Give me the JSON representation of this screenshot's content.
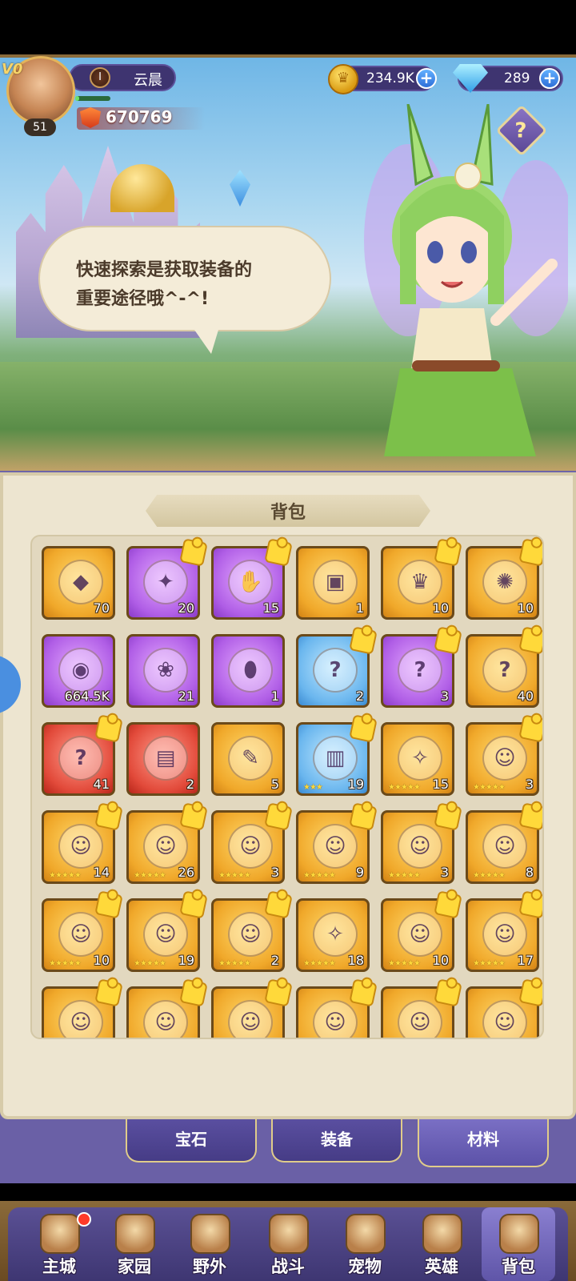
{
  "header": {
    "vip_label": "V0",
    "player_level": "51",
    "rank_icon_text": "I",
    "player_name": "云晨",
    "power": "670769",
    "xp_fraction": 0.12,
    "gold": "234.9K",
    "gems": "289",
    "help_label": "?"
  },
  "banner": {
    "dialog_line1": "快速探索是获取装备的",
    "dialog_line2": "重要途径哦^-^!"
  },
  "panel": {
    "title": "背包"
  },
  "inventory": [
    {
      "rarity": "gold",
      "icon": "gem-crystal-icon",
      "count": "70",
      "puzzle": false
    },
    {
      "rarity": "purple",
      "icon": "purple-orb-icon",
      "count": "20",
      "puzzle": true
    },
    {
      "rarity": "purple",
      "icon": "purple-hand-icon",
      "count": "15",
      "puzzle": true
    },
    {
      "rarity": "gold",
      "icon": "treasure-chest-icon",
      "count": "1",
      "puzzle": false
    },
    {
      "rarity": "gold",
      "icon": "gold-crown-icon",
      "count": "10",
      "puzzle": true
    },
    {
      "rarity": "gold",
      "icon": "gold-orb-icon",
      "count": "10",
      "puzzle": true
    },
    {
      "rarity": "purple",
      "icon": "rune-stone-icon",
      "count": "664.5K",
      "puzzle": false
    },
    {
      "rarity": "purple",
      "icon": "paw-scroll-icon",
      "count": "21",
      "puzzle": false
    },
    {
      "rarity": "purple",
      "icon": "egg-icon",
      "count": "1",
      "puzzle": false
    },
    {
      "rarity": "blue",
      "icon": "mystery-pet-icon",
      "count": "2",
      "puzzle": true
    },
    {
      "rarity": "purple",
      "icon": "mystery-pet-icon",
      "count": "3",
      "puzzle": true
    },
    {
      "rarity": "gold",
      "icon": "mystery-pet-icon",
      "count": "40",
      "puzzle": true
    },
    {
      "rarity": "red",
      "icon": "mystery-pet-icon",
      "count": "41",
      "puzzle": true
    },
    {
      "rarity": "red",
      "icon": "spell-book-icon",
      "count": "2",
      "puzzle": false
    },
    {
      "rarity": "gold",
      "icon": "scroll-icon",
      "count": "5",
      "puzzle": false
    },
    {
      "rarity": "blue",
      "icon": "armor-icon",
      "count": "19",
      "puzzle": true,
      "stars": "★★★"
    },
    {
      "rarity": "gold",
      "icon": "hero-fragment-icon",
      "count": "15",
      "puzzle": false,
      "stars": "★★★★★"
    },
    {
      "rarity": "gold",
      "icon": "hero-portrait-icon",
      "count": "3",
      "puzzle": true,
      "stars": "★★★★★"
    },
    {
      "rarity": "gold",
      "icon": "hero-portrait-icon",
      "count": "14",
      "puzzle": true,
      "stars": "★★★★★"
    },
    {
      "rarity": "gold",
      "icon": "hero-portrait-icon",
      "count": "26",
      "puzzle": true,
      "stars": "★★★★★"
    },
    {
      "rarity": "gold",
      "icon": "hero-portrait-icon",
      "count": "3",
      "puzzle": true,
      "stars": "★★★★★"
    },
    {
      "rarity": "gold",
      "icon": "hero-portrait-icon",
      "count": "9",
      "puzzle": true,
      "stars": "★★★★★"
    },
    {
      "rarity": "gold",
      "icon": "hero-portrait-icon",
      "count": "3",
      "puzzle": true,
      "stars": "★★★★★"
    },
    {
      "rarity": "gold",
      "icon": "hero-portrait-icon",
      "count": "8",
      "puzzle": true,
      "stars": "★★★★★"
    },
    {
      "rarity": "gold",
      "icon": "hero-portrait-icon",
      "count": "10",
      "puzzle": true,
      "stars": "★★★★★"
    },
    {
      "rarity": "gold",
      "icon": "hero-portrait-icon",
      "count": "19",
      "puzzle": true,
      "stars": "★★★★★"
    },
    {
      "rarity": "gold",
      "icon": "hero-portrait-icon",
      "count": "2",
      "puzzle": true,
      "stars": "★★★★★"
    },
    {
      "rarity": "gold",
      "icon": "hero-fragment-icon",
      "count": "18",
      "puzzle": false,
      "stars": "★★★★★"
    },
    {
      "rarity": "gold",
      "icon": "hero-portrait-icon",
      "count": "10",
      "puzzle": true,
      "stars": "★★★★★"
    },
    {
      "rarity": "gold",
      "icon": "hero-portrait-icon",
      "count": "17",
      "puzzle": true,
      "stars": "★★★★★"
    },
    {
      "rarity": "gold",
      "icon": "hero-portrait-icon",
      "count": "",
      "puzzle": true
    },
    {
      "rarity": "gold",
      "icon": "hero-portrait-icon",
      "count": "",
      "puzzle": true
    },
    {
      "rarity": "gold",
      "icon": "hero-portrait-icon",
      "count": "",
      "puzzle": true
    },
    {
      "rarity": "gold",
      "icon": "hero-portrait-icon",
      "count": "",
      "puzzle": true
    },
    {
      "rarity": "gold",
      "icon": "hero-portrait-icon",
      "count": "",
      "puzzle": true
    },
    {
      "rarity": "gold",
      "icon": "hero-portrait-icon",
      "count": "",
      "puzzle": true
    }
  ],
  "subtabs": [
    {
      "label": "宝石",
      "active": false
    },
    {
      "label": "装备",
      "active": false
    },
    {
      "label": "材料",
      "active": true
    }
  ],
  "nav": [
    {
      "label": "主城",
      "icon": "castle-icon",
      "badge": true,
      "active": false
    },
    {
      "label": "家园",
      "icon": "house-icon",
      "badge": false,
      "active": false
    },
    {
      "label": "野外",
      "icon": "mushroom-house-icon",
      "badge": false,
      "active": false
    },
    {
      "label": "战斗",
      "icon": "sword-icon",
      "badge": false,
      "active": false
    },
    {
      "label": "宠物",
      "icon": "pet-icon",
      "badge": false,
      "active": false
    },
    {
      "label": "英雄",
      "icon": "hero-book-icon",
      "badge": false,
      "active": false
    },
    {
      "label": "背包",
      "icon": "backpack-icon",
      "badge": false,
      "active": true
    }
  ],
  "colors": {
    "accent_purple": "#5d519a",
    "panel_bg": "#ede5d0",
    "gold": "#f0a82a",
    "plus_blue": "#2e6fd8"
  }
}
